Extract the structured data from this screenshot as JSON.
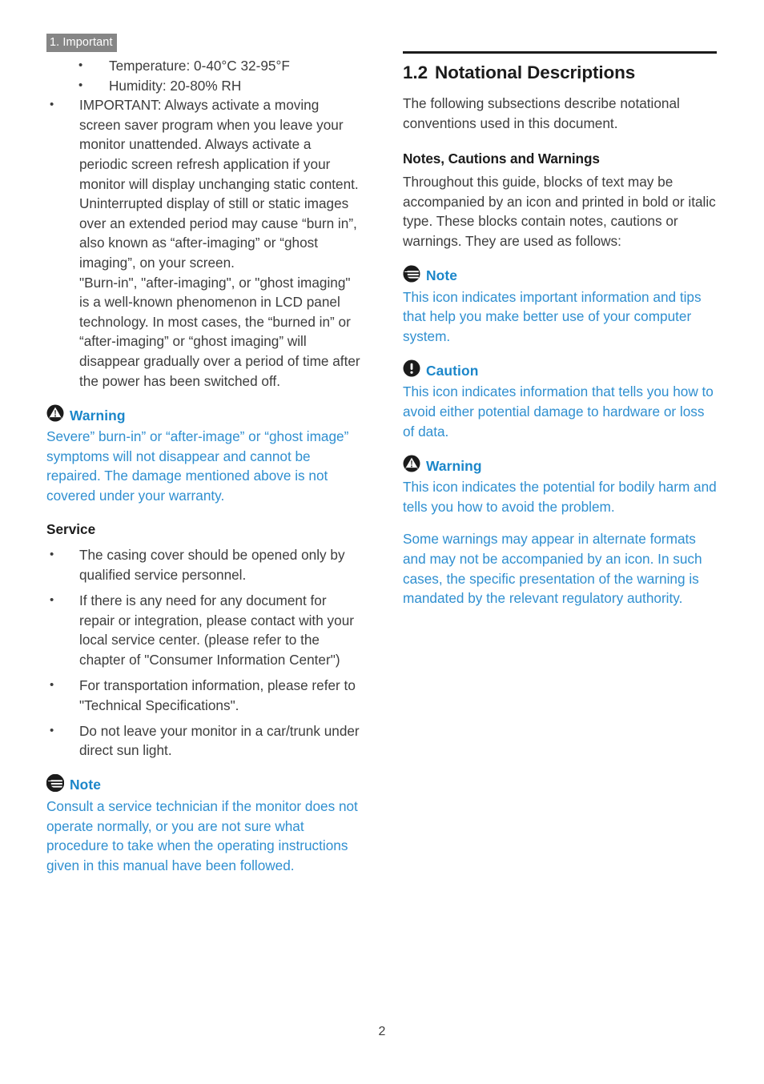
{
  "colors": {
    "accent_blue": "#2f8fd0",
    "heading_blue": "#1b86c9",
    "runhead_bg": "#868686",
    "body_text": "#3d3d3d",
    "rule": "#1b1b1b"
  },
  "running_head": "1. Important",
  "left_column": {
    "bullets": [
      {
        "level": "sub",
        "text": "Temperature: 0-40°C 32-95°F"
      },
      {
        "level": "sub",
        "text": "Humidity: 20-80% RH"
      },
      {
        "level": "main",
        "text": "IMPORTANT: Always activate a moving screen saver program when you leave your monitor unattended. Always activate a periodic screen refresh application if your monitor will display unchanging static content. Uninterrupted display of still or static images over an extended period may cause “burn in”, also known as “after-imaging” or “ghost imaging”, on your screen.\n\"Burn-in\", \"after-imaging\", or \"ghost imaging\" is a well-known phenomenon in LCD panel technology. In most cases, the “burned in” or “after-imaging” or “ghost imaging” will disappear gradually over a period of time after the power has been switched off."
      }
    ],
    "warning": {
      "icon": "warning-triangle-icon",
      "label": "Warning",
      "text": "Severe” burn-in” or “after-image” or “ghost image” symptoms will not disappear and cannot be repaired. The damage mentioned above is not covered under your warranty."
    },
    "service_heading": "Service",
    "service_bullets": [
      "The casing cover should be opened only by qualified service personnel.",
      "If there is any need for any document for repair or integration, please contact with your local service center. (please refer to the chapter of \"Consumer Information Center\")",
      "For transportation information, please refer to \"Technical Specifications\".",
      "Do not leave your monitor in a car/trunk under direct sun light."
    ],
    "note": {
      "icon": "note-icon",
      "label": "Note",
      "text": "Consult a service technician if the monitor does not operate normally, or you are not sure what procedure to take when the operating instructions given in this manual have been followed."
    }
  },
  "right_column": {
    "section_number": "1.2",
    "section_title": "Notational Descriptions",
    "intro": "The following subsections describe notational conventions used in this document.",
    "subsection_title": "Notes, Cautions and Warnings",
    "subsection_intro": "Throughout this guide, blocks of text may be accompanied by an icon and printed in bold or italic type. These blocks contain notes, cautions or warnings. They are used as follows:",
    "note": {
      "icon": "note-icon",
      "label": "Note",
      "text": "This icon indicates important information and tips that help you make better use of your computer system."
    },
    "caution": {
      "icon": "caution-exclamation-icon",
      "label": "Caution",
      "text": "This icon indicates information that tells you how to avoid either potential damage to hardware or loss of data."
    },
    "warning": {
      "icon": "warning-triangle-icon",
      "label": "Warning",
      "text": "This icon indicates the potential for bodily harm and tells you how to avoid the problem.",
      "text2": "Some warnings may appear in alternate formats and may not be accompanied by an icon. In such cases, the specific presentation of the warning is mandated by the relevant regulatory authority."
    }
  },
  "folio": "2"
}
